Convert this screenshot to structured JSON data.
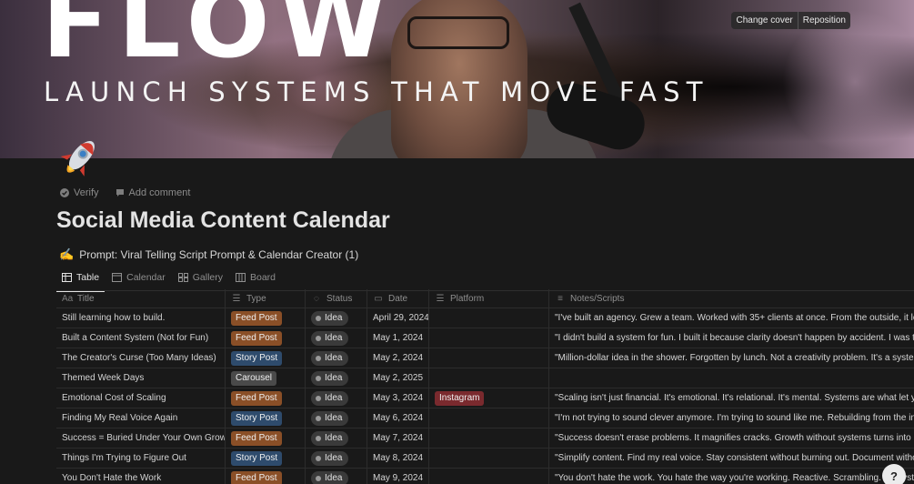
{
  "cover": {
    "headline": "FLOW",
    "tagline": "LAUNCH SYSTEMS THAT MOVE FAST",
    "change_cover_label": "Change cover",
    "reposition_label": "Reposition"
  },
  "page": {
    "icon": "rocket-icon",
    "verify_label": "Verify",
    "add_comment_label": "Add comment",
    "title": "Social Media Content Calendar",
    "prompt_emoji": "✍",
    "prompt_link": "Prompt: Viral Telling Script Prompt & Calendar Creator (1)"
  },
  "tabs": [
    {
      "label": "Table",
      "icon": "table-icon",
      "active": true
    },
    {
      "label": "Calendar",
      "icon": "calendar-icon",
      "active": false
    },
    {
      "label": "Gallery",
      "icon": "gallery-icon",
      "active": false
    },
    {
      "label": "Board",
      "icon": "board-icon",
      "active": false
    }
  ],
  "table": {
    "columns": [
      {
        "label": "Title",
        "icon": "Aa"
      },
      {
        "label": "Type",
        "icon": "☰"
      },
      {
        "label": "Status",
        "icon": "◌"
      },
      {
        "label": "Date",
        "icon": "▭"
      },
      {
        "label": "Platform",
        "icon": "☰"
      },
      {
        "label": "Notes/Scripts",
        "icon": "≡"
      }
    ],
    "rows": [
      {
        "title": "Still learning how to build.",
        "type": "Feed Post",
        "status": "Idea",
        "date": "April 29, 2024",
        "platform": "",
        "notes": "\"I've built an agency. Grew a team. Worked with 35+ clients at once. From the outside, it loo"
      },
      {
        "title": "Built a Content System (Not for Fun)",
        "type": "Feed Post",
        "status": "Idea",
        "date": "May 1, 2024",
        "platform": "",
        "notes": "\"I didn't build a system for fun. I built it because clarity doesn't happen by accident. I was tir"
      },
      {
        "title": "The Creator's Curse (Too Many Ideas)",
        "type": "Story Post",
        "status": "Idea",
        "date": "May 2, 2024",
        "platform": "",
        "notes": "\"Million-dollar idea in the shower. Forgotten by lunch. Not a creativity problem. It's a system"
      },
      {
        "title": "Themed Week Days",
        "type": "Carousel",
        "status": "Idea",
        "date": "May 2, 2025",
        "platform": "",
        "notes": ""
      },
      {
        "title": "Emotional Cost of Scaling",
        "type": "Feed Post",
        "status": "Idea",
        "date": "May 3, 2024",
        "platform": "Instagram",
        "notes": "\"Scaling isn't just financial. It's emotional. It's relational. It's mental. Systems are what let you"
      },
      {
        "title": "Finding My Real Voice Again",
        "type": "Story Post",
        "status": "Idea",
        "date": "May 6, 2024",
        "platform": "",
        "notes": "\"I'm not trying to sound clever anymore. I'm trying to sound like me. Rebuilding from the insi"
      },
      {
        "title": "Success = Buried Under Your Own Growth",
        "type": "Feed Post",
        "status": "Idea",
        "date": "May 7, 2024",
        "platform": "",
        "notes": "\"Success doesn't erase problems. It magnifies cracks. Growth without systems turns into m"
      },
      {
        "title": "Things I'm Trying to Figure Out",
        "type": "Story Post",
        "status": "Idea",
        "date": "May 8, 2024",
        "platform": "",
        "notes": "\"Simplify content. Find my real voice. Stay consistent without burning out. Document withou"
      },
      {
        "title": "You Don't Hate the Work",
        "type": "Feed Post",
        "status": "Idea",
        "date": "May 9, 2024",
        "platform": "",
        "notes": "\"You don't hate the work. You hate the way you're working. Reactive. Scrambling. No syste"
      }
    ]
  },
  "help_label": "?",
  "colors": {
    "background": "#191919",
    "feed_post": "#8a4f27",
    "story_post": "#2e4b6c",
    "carousel": "#4a4a4a",
    "instagram": "#7a2a2e"
  }
}
